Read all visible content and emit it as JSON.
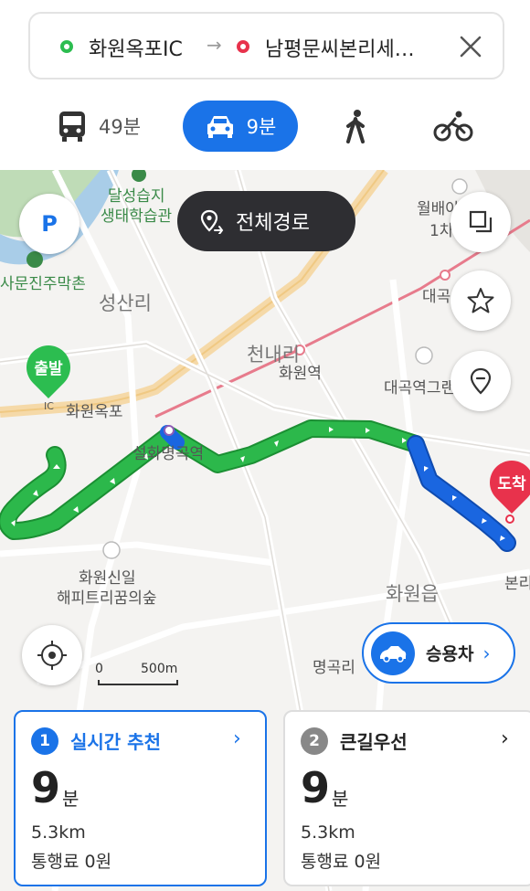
{
  "route": {
    "origin": "화원옥포IC",
    "arrow": "→",
    "destination": "남평문씨본리세…"
  },
  "modes": {
    "bus_time": "49분",
    "car_time": "9분"
  },
  "map": {
    "labels": {
      "dalseong": "달성습지",
      "ecocenter": "생태학습관",
      "moonjin": "사문진주막촌",
      "seongsanri": "성산리",
      "cheonnae": "천내리",
      "hwawon_station": "화원역",
      "daegok": "대곡",
      "wolbae": "월배아",
      "ilcha": "1차",
      "daegokgrand": "대곡역그랜",
      "hwawon_okpo": "화원옥포",
      "seolhwa": "설화명곡역",
      "hwawon_shinil": "화원신일",
      "happytree": "해피트리꿈의숲",
      "hwawon_eup": "화원읍",
      "myeonggok": "명곡리",
      "bonri": "본리",
      "ic": "IC"
    },
    "start_label": "출발",
    "end_label": "도착",
    "full_route_label": "전체경로",
    "parking_label": "P",
    "scale_zero": "0",
    "scale_distance": "500m",
    "vehicle_label": "승용차",
    "route_colors": {
      "smooth": "#2cb84b",
      "slow": "#1a66e0"
    }
  },
  "options": [
    {
      "number": "1",
      "title": "실시간 추천",
      "time": "9",
      "unit": "분",
      "distance": "5.3km",
      "toll": "통행료 0원"
    },
    {
      "number": "2",
      "title": "큰길우선",
      "time": "9",
      "unit": "분",
      "distance": "5.3km",
      "toll": "통행료 0원"
    }
  ]
}
